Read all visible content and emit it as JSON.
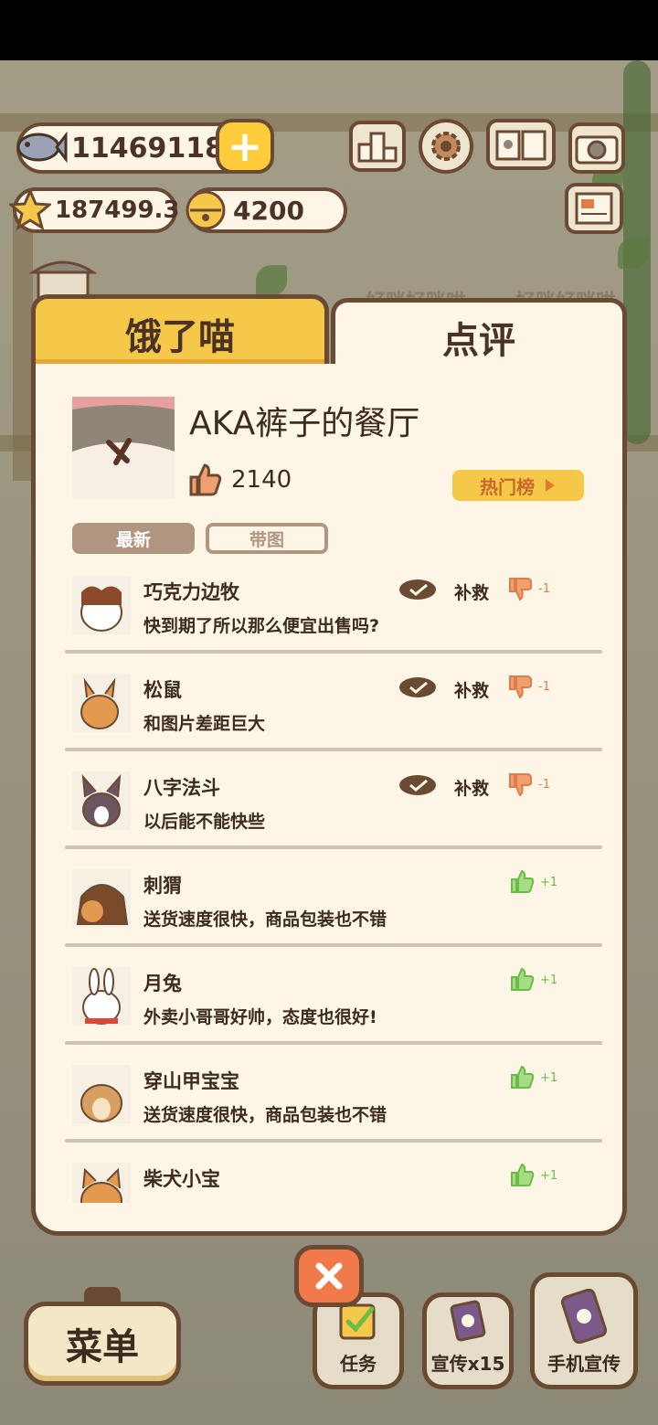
{
  "resources": {
    "fish": "11469118",
    "stars": "187499.3",
    "bells": "4200"
  },
  "background_text": [
    "好咪好咪哄",
    "好咪好咪哄"
  ],
  "tabs": {
    "hungry": "饿了喵",
    "review": "点评"
  },
  "restaurant": {
    "name": "AKA裤子的餐厅",
    "likes": "2140",
    "hot_label": "热门榜"
  },
  "filters": {
    "latest": "最新",
    "with_image": "带图"
  },
  "reviews": [
    {
      "user": "巧克力边牧",
      "text": "快到期了所以那么便宜出售吗?",
      "remedy": "补救",
      "score": "-1",
      "sentiment": "negative"
    },
    {
      "user": "松鼠",
      "text": "和图片差距巨大",
      "remedy": "补救",
      "score": "-1",
      "sentiment": "negative"
    },
    {
      "user": "八字法斗",
      "text": "以后能不能快些",
      "remedy": "补救",
      "score": "-1",
      "sentiment": "negative"
    },
    {
      "user": "刺猬",
      "text": "送货速度很快，商品包装也不错",
      "score": "+1",
      "sentiment": "positive"
    },
    {
      "user": "月兔",
      "text": "外卖小哥哥好帅，态度也很好!",
      "score": "+1",
      "sentiment": "positive"
    },
    {
      "user": "穿山甲宝宝",
      "text": "送货速度很快，商品包装也不错",
      "score": "+1",
      "sentiment": "positive"
    },
    {
      "user": "柴犬小宝",
      "text": "",
      "score": "+1",
      "sentiment": "positive"
    }
  ],
  "bottom": {
    "menu": "菜单",
    "task": "任务",
    "promo": "宣传x15",
    "phone_promo": "手机宣传"
  },
  "colors": {
    "panel_bg": "#fdf6e6",
    "border": "#6b4a33",
    "tab_active": "#f6c84a",
    "like_green": "#6bbb47",
    "dislike_orange": "#e07b4a",
    "close_red": "#f07a4a"
  },
  "icons": [
    "fish-icon",
    "plus-icon",
    "star-icon",
    "bell-icon",
    "ranking-icon",
    "gear-icon",
    "book-icon",
    "camera-icon",
    "newspaper-icon",
    "shop-icon",
    "thumb-up-icon",
    "thumb-down-icon",
    "reply-bubble-icon",
    "play-arrow-icon",
    "close-icon",
    "task-check-icon",
    "promo-card-icon",
    "phone-icon"
  ]
}
